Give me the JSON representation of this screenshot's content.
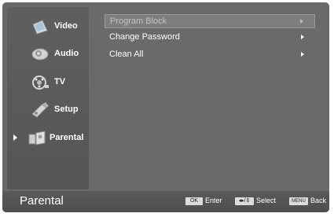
{
  "sidebar": {
    "items": [
      {
        "label": "Video",
        "icon": "video-icon"
      },
      {
        "label": "Audio",
        "icon": "audio-icon"
      },
      {
        "label": "TV",
        "icon": "tv-icon"
      },
      {
        "label": "Setup",
        "icon": "setup-icon"
      },
      {
        "label": "Parental",
        "icon": "parental-icon",
        "selected": true
      }
    ]
  },
  "menu": {
    "items": [
      {
        "label": "Program Block",
        "highlighted": true
      },
      {
        "label": "Change Password"
      },
      {
        "label": "Clean All"
      }
    ]
  },
  "footer": {
    "title": "Parental",
    "ok_key": "OK",
    "ok_hint": "Enter",
    "select_key": "◂▸/⇕",
    "select_hint": "Select",
    "menu_key": "MENU",
    "menu_hint": "Back"
  }
}
